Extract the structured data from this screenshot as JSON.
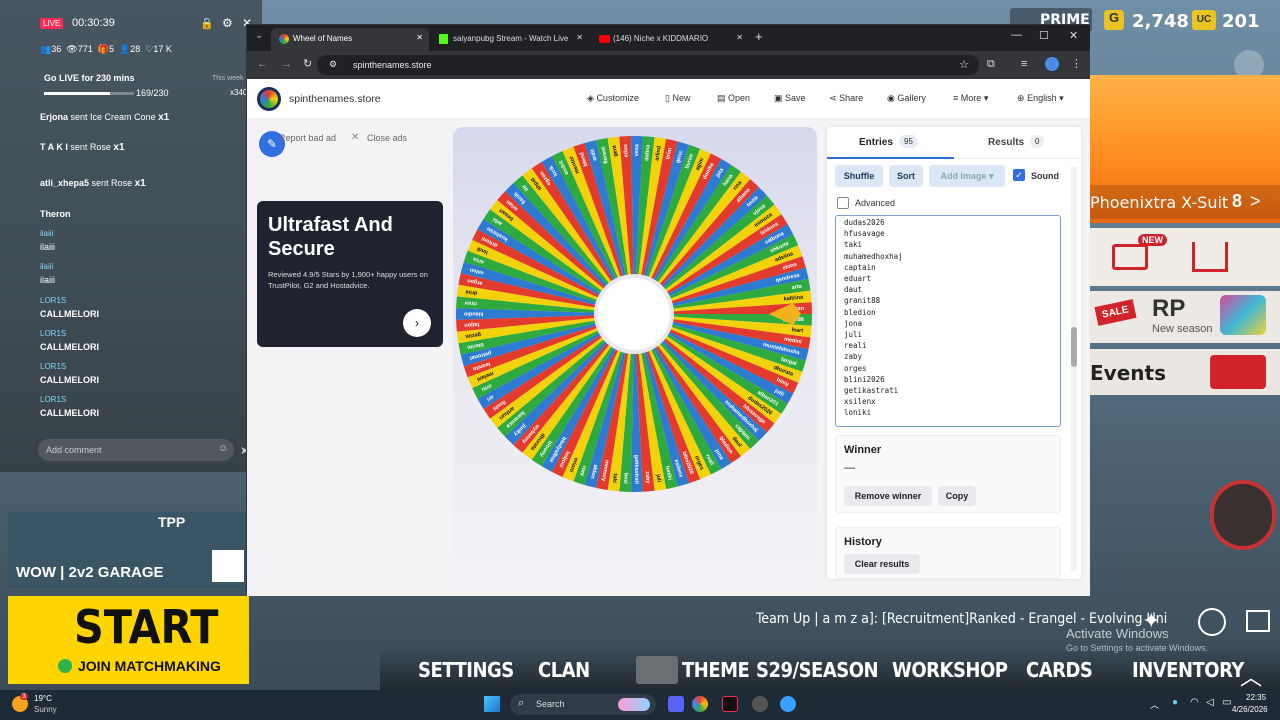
{
  "game": {
    "tier_label": "PRIME",
    "currency_g": "2,748",
    "currency_uc": "201",
    "suit_name": "Phoenixtra X-Suit",
    "suit_nav": "8",
    "suit_new_badge": "NEW",
    "store_new_badge": "NEW",
    "rp_label": "RP",
    "rp_sub": "New season",
    "sale_label": "SALE",
    "events_label": "Events",
    "team_up": "Team Up | a m z a]: [Recruitment]Ranked - Erangel - Evolving Uni",
    "activate_title": "Activate Windows",
    "activate_sub": "Go to Settings to activate Windows.",
    "menu": [
      "SETTINGS",
      "CLAN",
      "THEME",
      "S29/SEASON",
      "WORKSHOP",
      "CARDS",
      "INVENTORY"
    ],
    "garage_tile": "WOW | 2v2 GARAGE",
    "garage_tpp": "TPP",
    "start_label": "START",
    "start_sub": "JOIN MATCHMAKING"
  },
  "live": {
    "live_badge": "LIVE",
    "timer": "00:30:39",
    "stats": [
      "36",
      "771",
      "5",
      "28",
      "17 K"
    ],
    "goal": "Go LIVE for 230 mins",
    "goal_period": "This week",
    "goal_progress": "169/230",
    "goal_bonus": "x340",
    "gifts": [
      {
        "user": "Erjona",
        "text": "sent Ice Cream Cone",
        "count": "x1"
      },
      {
        "user": "T A K I",
        "text": "sent Rose",
        "count": "x1"
      },
      {
        "user": "atli_xhepa5",
        "text": "sent Rose",
        "count": "x1"
      }
    ],
    "chat": [
      {
        "user": "Theron",
        "msg": ""
      },
      {
        "user": "ilaiii",
        "msg": "ilaiii"
      },
      {
        "user": "ilaiii",
        "msg": "ilaiii"
      },
      {
        "user": "LOR1S",
        "msg": "CALLMELORI"
      },
      {
        "user": "LOR1S",
        "msg": "CALLMELORI"
      },
      {
        "user": "LOR1S",
        "msg": "CALLMELORI"
      },
      {
        "user": "LOR1S",
        "msg": "CALLMELORI"
      }
    ],
    "comment_placeholder": "Add comment"
  },
  "browser": {
    "tabs": [
      {
        "label": "Wheel of Names",
        "active": true
      },
      {
        "label": "saiyanpubg Stream - Watch Live",
        "active": false
      },
      {
        "label": "(146) Niche x KIDDMARIO",
        "active": false
      }
    ],
    "url": "spinthenames.store"
  },
  "site": {
    "name": "spinthenames.store",
    "nav": [
      "Customize",
      "New",
      "Open",
      "Save",
      "Share",
      "Gallery",
      "More",
      "English"
    ],
    "report_ad": "Report bad ad",
    "close_ads": "Close ads",
    "ad_title": "Ultrafast And Secure",
    "ad_body": "Reviewed 4.9/5 Stars by 1,900+ happy users on TrustPilot, G2 and Hostadvice.",
    "tabs": {
      "entries": "Entries",
      "entries_count": "95",
      "results": "Results",
      "results_count": "0"
    },
    "buttons": {
      "shuffle": "Shuffle",
      "sort": "Sort",
      "add_image": "Add image",
      "sound": "Sound",
      "advanced": "Advanced"
    },
    "entries": [
      "dudas2026",
      "hfusavage",
      "taki",
      "muhamedhoxhaj",
      "captain",
      "eduart",
      "daut",
      "granit88",
      "bledion",
      "jona",
      "juli",
      "reali",
      "zaby",
      "orges",
      "blini2026",
      "getikastrati",
      "xsilenx",
      "loniki"
    ],
    "winner_title": "Winner",
    "winner_value": "—",
    "remove_winner": "Remove winner",
    "copy": "Copy",
    "history_title": "History",
    "clear_results": "Clear results"
  },
  "wheel_names": [
    "granit88",
    "leart",
    "medini",
    "mustafahoxha",
    "fangai",
    "dhurata",
    "himy",
    "jolli",
    "alban201",
    "dudas2026",
    "hfusavage",
    "muhamedhoxhaj",
    "captain",
    "daut",
    "bledion",
    "jona",
    "reali",
    "orges",
    "blini2026",
    "xsilenx",
    "loniki",
    "juli",
    "zaby",
    "getikastrati",
    "besi",
    "taki",
    "memory",
    "aldon",
    "roni",
    "erioni",
    "ledjoni",
    "blodyalboz",
    "bloony",
    "dhurata",
    "wybenny",
    "junky",
    "baranica",
    "arthuri",
    "iloshi",
    "ari",
    "ortu",
    "melani",
    "leonita",
    "petronat",
    "blerim",
    "gezim",
    "fatjon",
    "klaudio",
    "rinor",
    "drini",
    "argon",
    "valon",
    "erza",
    "lindi",
    "dritoni",
    "kushtrim",
    "arbi",
    "besart",
    "artan",
    "fisnik",
    "ilir",
    "shpat",
    "egzon",
    "lorik",
    "endrit",
    "mentor",
    "blend",
    "ardit",
    "florent",
    "gent",
    "edon",
    "vesa",
    "dafina",
    "arlind",
    "lirim",
    "genc",
    "burim",
    "agim",
    "donika",
    "jeta",
    "hana",
    "rina",
    "albana",
    "teuta",
    "vjosa",
    "mimoza",
    "liridona",
    "valbona",
    "shkurte",
    "adelina",
    "elona",
    "qendresa",
    "arta",
    "kaltrina",
    "saiyan"
  ],
  "wheel_colors": [
    "#2eaa3e",
    "#f2d20a",
    "#e23b2e",
    "#2f7ad1"
  ],
  "taskbar": {
    "weather_temp": "19°C",
    "weather_desc": "Sunny",
    "search": "Search",
    "time": "22:35",
    "date": "4/26/2026",
    "notif": "3"
  }
}
